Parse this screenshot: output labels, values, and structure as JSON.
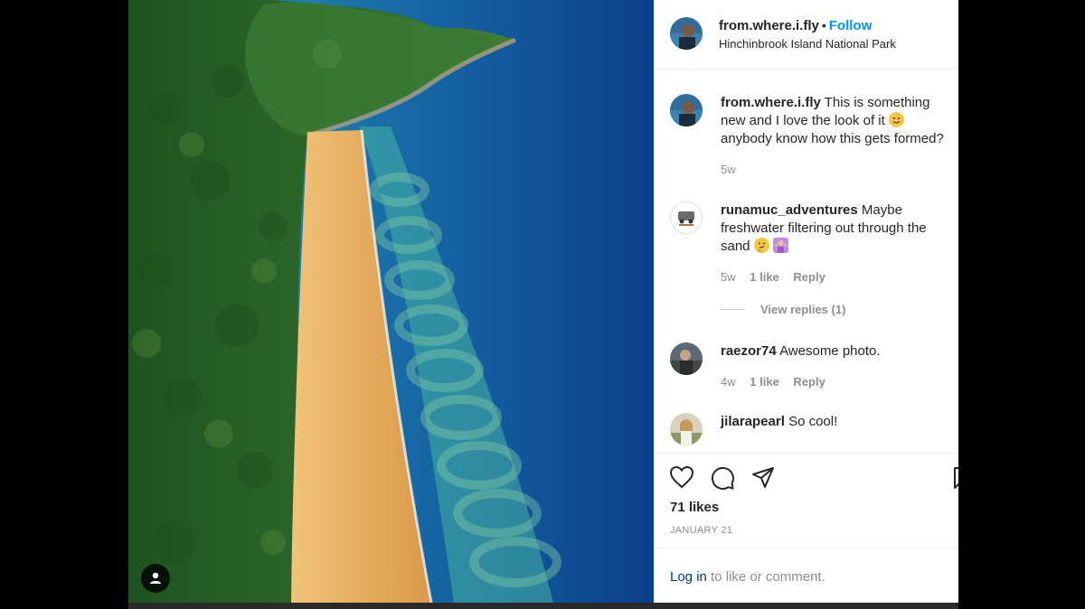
{
  "post": {
    "username": "from.where.i.fly",
    "separator": "•",
    "follow_label": "Follow",
    "location": "Hinchinbrook Island National Park"
  },
  "photo": {
    "subject": "Aerial view of green forest, long golden sand beach and turquoise-to-deep-blue sea with swirl patterns",
    "colors": {
      "sea_deep": "#0b3f8a",
      "sea_mid": "#1667a5",
      "shallow": "#3fa9a3",
      "sand": "#e3a85a",
      "forest": "#2f6b2a"
    }
  },
  "comments": [
    {
      "username": "from.where.i.fly",
      "text_a": "This is something new and I love the look of it",
      "emoji_a": "smiling-face-emoji",
      "text_b": "anybody know how this gets formed?",
      "time": "5w"
    },
    {
      "username": "runamuc_adventures",
      "text_a": "Maybe freshwater filtering out through the sand",
      "emoji_a": "thinking-face-emoji",
      "emoji_b": "person-shrugging-emoji",
      "time": "5w",
      "likes": "1 like",
      "reply": "Reply",
      "view_replies": "View replies (1)"
    },
    {
      "username": "raezor74",
      "text_a": "Awesome photo.",
      "time": "4w",
      "likes": "1 like",
      "reply": "Reply"
    },
    {
      "username": "jilarapearl",
      "text_a": "So cool!"
    }
  ],
  "actions": {
    "icons": [
      "heart-icon",
      "comment-icon",
      "share-icon",
      "bookmark-icon"
    ],
    "likes": "71 likes",
    "date": "JANUARY 21"
  },
  "login": {
    "link": "Log in",
    "rest": " to like or comment."
  }
}
